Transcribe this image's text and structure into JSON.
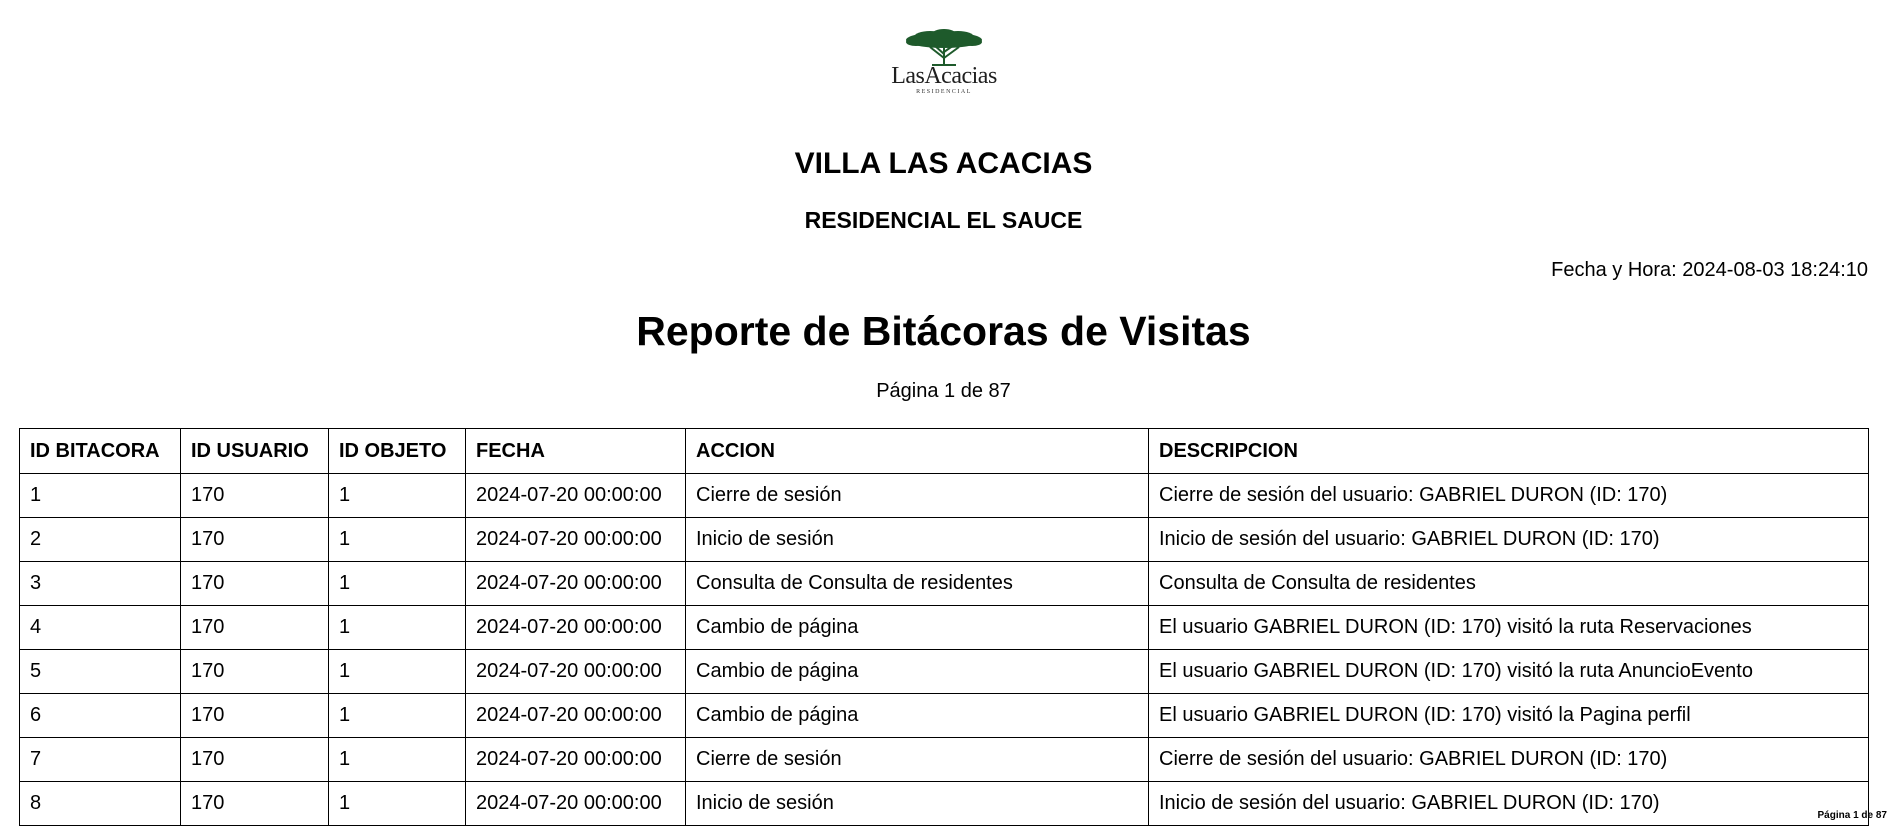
{
  "logo": {
    "name": "LasAcacias",
    "subtitle": "RESIDENCIAL",
    "icon": "acacia-tree-icon",
    "color": "#1e5a2b"
  },
  "header": {
    "title": "VILLA LAS ACACIAS",
    "subtitle": "RESIDENCIAL EL SAUCE",
    "datetime": "Fecha y Hora: 2024-08-03 18:24:10"
  },
  "report": {
    "title": "Reporte de Bitácoras de Visitas",
    "page": "Página 1 de 87"
  },
  "table": {
    "columns": [
      "ID BITACORA",
      "ID USUARIO",
      "ID OBJETO",
      "FECHA",
      "ACCION",
      "DESCRIPCION"
    ],
    "rows": [
      [
        "1",
        "170",
        "1",
        "2024-07-20 00:00:00",
        "Cierre de sesión",
        "Cierre de sesión del usuario: GABRIEL DURON (ID: 170)"
      ],
      [
        "2",
        "170",
        "1",
        "2024-07-20 00:00:00",
        "Inicio de sesión",
        "Inicio de sesión del usuario: GABRIEL DURON (ID: 170)"
      ],
      [
        "3",
        "170",
        "1",
        "2024-07-20 00:00:00",
        "Consulta de Consulta de residentes",
        "Consulta de Consulta de residentes"
      ],
      [
        "4",
        "170",
        "1",
        "2024-07-20 00:00:00",
        "Cambio de página",
        "El usuario GABRIEL DURON (ID: 170) visitó la ruta Reservaciones"
      ],
      [
        "5",
        "170",
        "1",
        "2024-07-20 00:00:00",
        "Cambio de página",
        "El usuario GABRIEL DURON (ID: 170) visitó la ruta AnuncioEvento"
      ],
      [
        "6",
        "170",
        "1",
        "2024-07-20 00:00:00",
        "Cambio de página",
        "El usuario GABRIEL DURON (ID: 170) visitó la Pagina perfil"
      ],
      [
        "7",
        "170",
        "1",
        "2024-07-20 00:00:00",
        "Cierre de sesión",
        "Cierre de sesión del usuario: GABRIEL DURON (ID: 170)"
      ],
      [
        "8",
        "170",
        "1",
        "2024-07-20 00:00:00",
        "Inicio de sesión",
        "Inicio de sesión del usuario: GABRIEL DURON (ID: 170)"
      ]
    ]
  },
  "footer": {
    "corner_text": "Página 1 de 87"
  }
}
